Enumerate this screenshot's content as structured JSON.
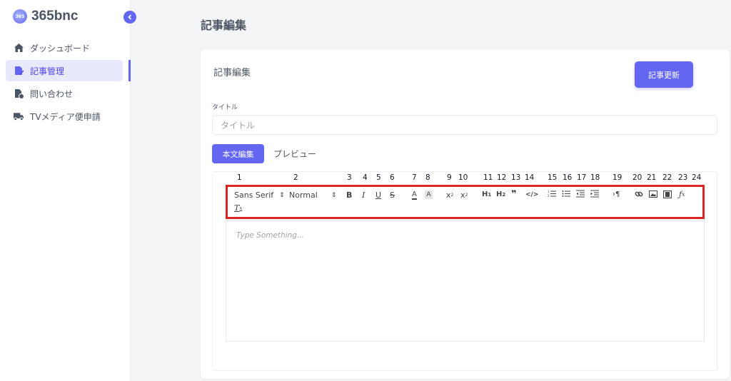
{
  "app": {
    "logo_text": "365bnc",
    "logo_mark": "365"
  },
  "sidebar": {
    "items": [
      {
        "label": "ダッシュボード",
        "icon": "home-icon"
      },
      {
        "label": "記事管理",
        "icon": "article-edit-icon",
        "active": true
      },
      {
        "label": "問い合わせ",
        "icon": "file-question-icon"
      },
      {
        "label": "TVメディア便申請",
        "icon": "truck-icon"
      }
    ]
  },
  "page": {
    "title": "記事編集"
  },
  "card": {
    "heading": "記事編集",
    "update_button": "記事更新",
    "title_label": "タイトル",
    "title_placeholder": "タイトル",
    "tabs": [
      "本文編集",
      "プレビュー"
    ]
  },
  "editor": {
    "font_select": "Sans Serif",
    "size_select": "Normal",
    "placeholder": "Type Something...",
    "tool_numbers": [
      "1",
      "2",
      "3",
      "4",
      "5",
      "6",
      "7",
      "8",
      "9",
      "10",
      "11",
      "12",
      "13",
      "14",
      "15",
      "16",
      "17",
      "18",
      "19",
      "20",
      "21",
      "22",
      "23",
      "24"
    ]
  },
  "colors": {
    "accent": "#6366f1",
    "highlight_outline": "#dc2626"
  }
}
